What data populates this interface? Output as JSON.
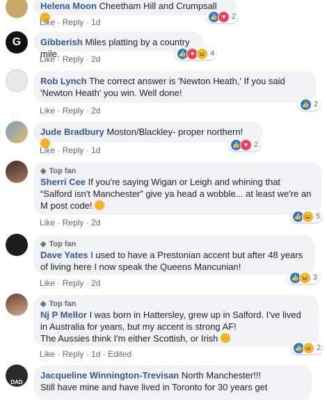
{
  "comments": [
    {
      "name": "Helena Moon",
      "text": "Cheetham Hill and Crumpsall",
      "time": "1d",
      "reacts": "2",
      "edited": "",
      "topfan": ""
    },
    {
      "name": "Gibberish",
      "text": "Miles platting by a country mile.",
      "time": "2d",
      "reacts": "4",
      "edited": "",
      "topfan": ""
    },
    {
      "name": "Rob Lynch",
      "text": "The correct answer is 'Newton Heath,' If you said 'Newton Heath' you win. Well done!",
      "time": "2d",
      "reacts": "2",
      "edited": "",
      "topfan": ""
    },
    {
      "name": "Jude Bradbury",
      "text": "Moston/Blackley- proper northern!",
      "time": "1d",
      "reacts": "2",
      "edited": "",
      "topfan": ""
    },
    {
      "name": "Sherri Cee",
      "text": "If you're saying Wigan or Leigh and whining that “Salford isn't Manchester” give ya head a wobble... at least we're an M post code!",
      "time": "2d",
      "reacts": "5",
      "edited": "",
      "topfan": "Top fan"
    },
    {
      "name": "Dave Yates",
      "text": "I used to have a Prestonian accent but after 48 years of living here I now speak the Queens Mancunian!",
      "time": "2d",
      "reacts": "3",
      "edited": "",
      "topfan": "Top fan"
    },
    {
      "name": "Nj P Mellor",
      "text": "I was born in Hattersley, grew up in Salford. I've lived in Australia for years, but my accent is strong AF!",
      "text2": "The Aussies think I'm either Scottish, or Irish",
      "time": "1d",
      "reacts": "2",
      "edited": "Edited",
      "topfan": "Top fan"
    },
    {
      "name": "Jacqueline Winnington-Trevisan",
      "text": "North Manchester!!!",
      "text2": "Still have mine and have lived in Toronto for 30 years get",
      "time": "",
      "reacts": "",
      "edited": "",
      "topfan": ""
    }
  ],
  "labels": {
    "like": "Like",
    "reply": "Reply",
    "dot": "·"
  },
  "avatar_colors": [
    "#c9a86a",
    "#111111",
    "#d8d8d8",
    "#7aa0c8",
    "#8a5a48",
    "#202020",
    "#b08070",
    "#2a2a2a"
  ],
  "avatar_labels": {
    "g": "G",
    "dad": "DAD"
  },
  "reaction_colors": {
    "like": "#1877f2",
    "love": "#f33e58",
    "haha": "#f7b125"
  }
}
